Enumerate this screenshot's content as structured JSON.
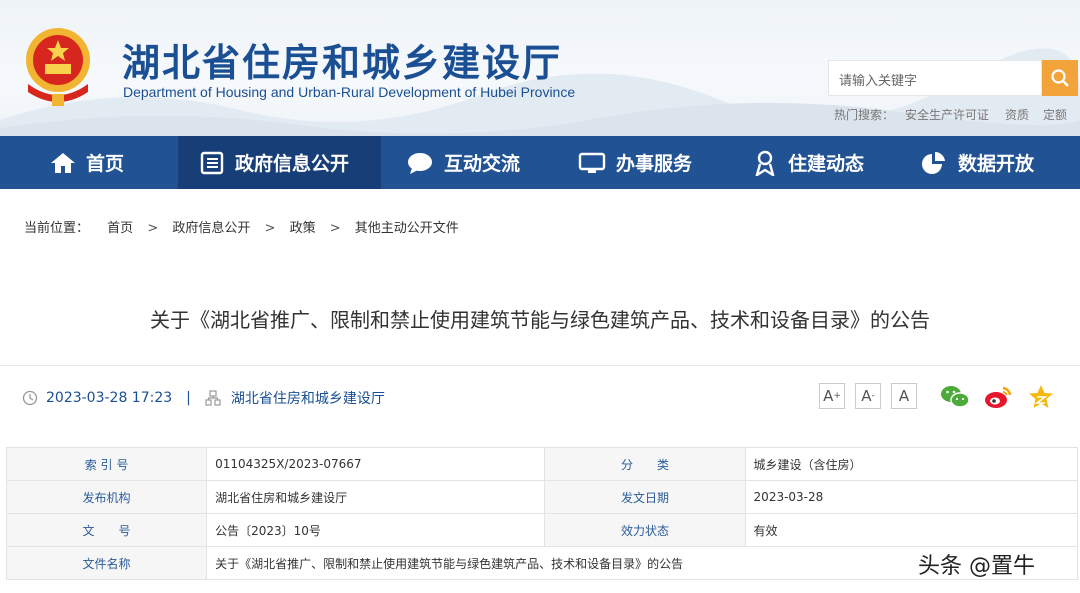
{
  "header": {
    "site_title": "湖北省住房和城乡建设厅",
    "site_subtitle": "Department of Housing and Urban-Rural Development of Hubei Province",
    "search_placeholder": "请输入关键字",
    "hot_label": "热门搜索：",
    "hot_items": [
      "安全生产许可证",
      "资质",
      "定额"
    ]
  },
  "nav": {
    "items": [
      {
        "label": "首页",
        "icon": "home-icon"
      },
      {
        "label": "政府信息公开",
        "icon": "document-list-icon"
      },
      {
        "label": "互动交流",
        "icon": "chat-bubble-icon"
      },
      {
        "label": "办事服务",
        "icon": "monitor-icon"
      },
      {
        "label": "住建动态",
        "icon": "person-badge-icon"
      },
      {
        "label": "数据开放",
        "icon": "pie-chart-icon"
      }
    ],
    "active": "政府信息公开"
  },
  "breadcrumb": {
    "prefix": "当前位置：",
    "items": [
      "首页",
      "政府信息公开",
      "政策",
      "其他主动公开文件"
    ],
    "separator": ">"
  },
  "article": {
    "title": "关于《湖北省推广、限制和禁止使用建筑节能与绿色建筑产品、技术和设备目录》的公告",
    "datetime": "2023-03-28 17:23",
    "meta_separator": "|",
    "source": "湖北省住房和城乡建设厅"
  },
  "font_controls": {
    "larger": "A",
    "larger_mark": "+",
    "smaller": "A",
    "smaller_mark": "-",
    "reset": "A"
  },
  "share": {
    "icons": [
      "wechat-icon",
      "weibo-icon",
      "qzone-star-icon"
    ]
  },
  "info_table": {
    "rows": [
      [
        {
          "label": "索 引 号",
          "value": "01104325X/2023-07667"
        },
        {
          "label": "分　　类",
          "value": "城乡建设（含住房）"
        }
      ],
      [
        {
          "label": "发布机构",
          "value": "湖北省住房和城乡建设厅"
        },
        {
          "label": "发文日期",
          "value": "2023-03-28"
        }
      ],
      [
        {
          "label": "文　　号",
          "value": "公告〔2023〕10号"
        },
        {
          "label": "效力状态",
          "value": "有效"
        }
      ]
    ],
    "name_row": {
      "label": "文件名称",
      "value": "关于《湖北省推广、限制和禁止使用建筑节能与绿色建筑产品、技术和设备目录》的公告"
    }
  },
  "watermark": "头条 @置牛",
  "colors": {
    "primary": "#215294",
    "nav_active": "#173e76",
    "search_button": "#f2a33a",
    "title_blue": "#1b4f93"
  }
}
